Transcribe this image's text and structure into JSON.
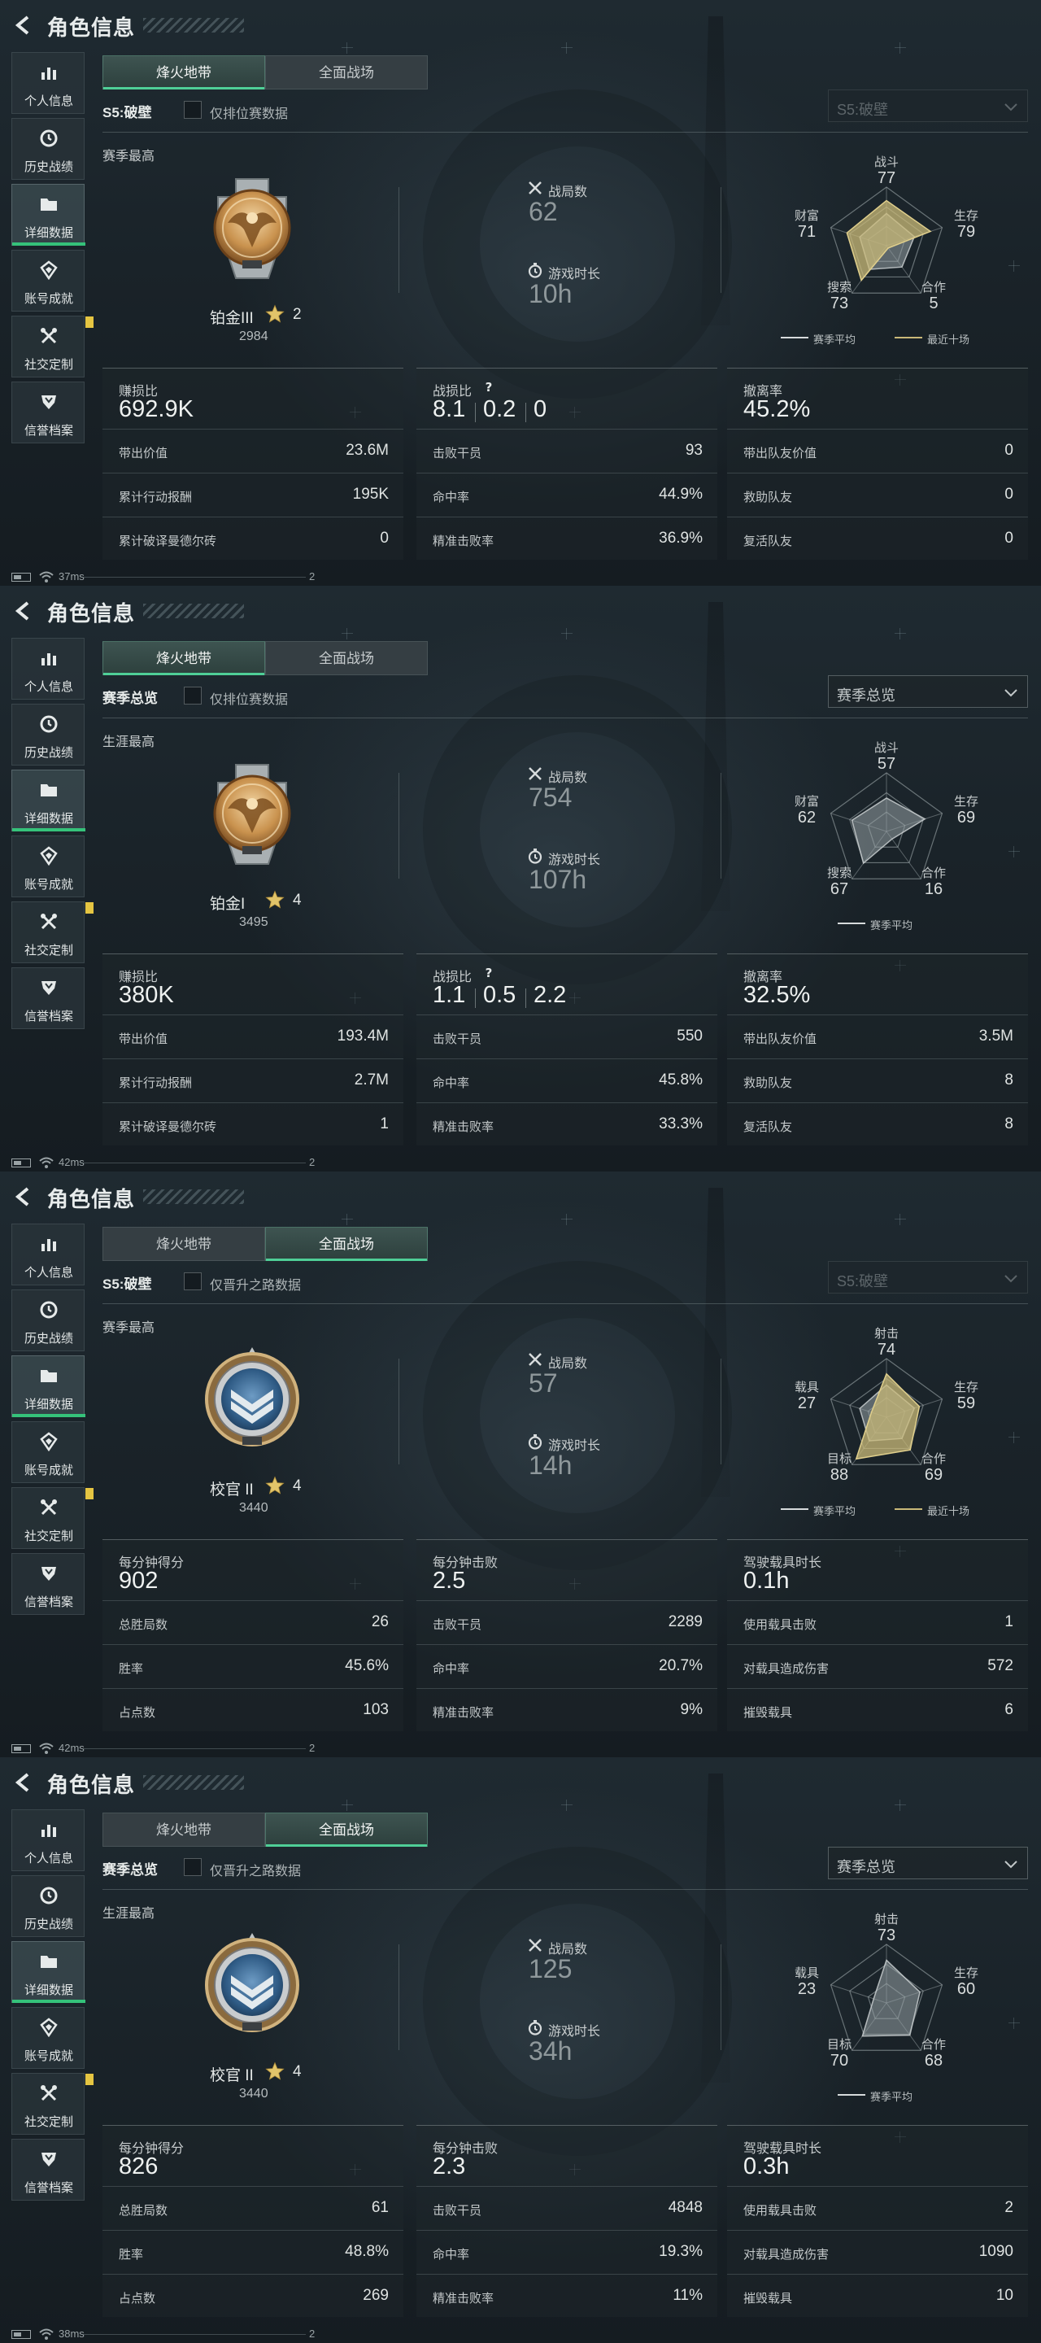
{
  "header": {
    "title": "角色信息"
  },
  "sidebar": {
    "items": [
      {
        "label": "个人信息"
      },
      {
        "label": "历史战绩"
      },
      {
        "label": "详细数据"
      },
      {
        "label": "账号成就"
      },
      {
        "label": "社交定制"
      },
      {
        "label": "信誉档案"
      }
    ]
  },
  "colors": {
    "accent_green": "#35c27a",
    "medal_gold": "#c9924e",
    "radar_current": "#c9b978",
    "radar_average": "#8c969a",
    "badge_yellow": "#e5c542"
  },
  "icons": [
    "back-arrow-icon",
    "stats-bars-icon",
    "history-clock-icon",
    "folder-icon",
    "achievement-badge-icon",
    "custom-tools-icon",
    "shield-rank-icon",
    "crossed-swords-icon",
    "stopwatch-icon",
    "help-question-icon",
    "star-icon",
    "chevron-down-icon",
    "battery-icon",
    "wifi-icon"
  ],
  "screens": [
    {
      "tabs": [
        {
          "label": "烽火地带"
        },
        {
          "label": "全面战场"
        }
      ],
      "active_tab": 0,
      "season_label": "S5:破壁",
      "checkbox_label": "仅排位赛数据",
      "select_value": "S5:破壁",
      "select_disabled": true,
      "best_label": "赛季最高",
      "medal_type": "gold-eagle",
      "rank_name": "铂金III",
      "rank_stars": "2",
      "rank_score": "2984",
      "matches_label": "战局数",
      "matches_value": "62",
      "time_label": "游戏时长",
      "time_value": "10h",
      "radar_labels": [
        "战斗",
        "生存",
        "合作",
        "搜索",
        "财富"
      ],
      "radar_values": [
        "77",
        "79",
        "5",
        "73",
        "71"
      ],
      "radar_avg": [
        0.55,
        0.5,
        0.45,
        0.5,
        0.48
      ],
      "radar_cur": [
        0.77,
        0.79,
        0.05,
        0.73,
        0.71
      ],
      "legend": [
        {
          "label": "赛季平均"
        },
        {
          "label": "最近十场"
        }
      ],
      "panels": [
        {
          "title": "赚损比",
          "big": [
            "692.9K"
          ],
          "rows": [
            {
              "label": "带出价值",
              "value": "23.6M"
            },
            {
              "label": "累计行动报酬",
              "value": "195K"
            },
            {
              "label": "累计破译曼德尔砖",
              "value": "0"
            }
          ]
        },
        {
          "title": "战损比",
          "help": true,
          "big": [
            "8.1",
            "0.2",
            "0"
          ],
          "rows": [
            {
              "label": "击败干员",
              "value": "93"
            },
            {
              "label": "命中率",
              "value": "44.9%"
            },
            {
              "label": "精准击败率",
              "value": "36.9%"
            }
          ]
        },
        {
          "title": "撤离率",
          "big": [
            "45.2%"
          ],
          "rows": [
            {
              "label": "带出队友价值",
              "value": "0"
            },
            {
              "label": "救助队友",
              "value": "0"
            },
            {
              "label": "复活队友",
              "value": "0"
            }
          ]
        }
      ],
      "status": {
        "ping": "37ms",
        "tail": "2"
      }
    },
    {
      "tabs": [
        {
          "label": "烽火地带"
        },
        {
          "label": "全面战场"
        }
      ],
      "active_tab": 0,
      "season_label": "赛季总览",
      "checkbox_label": "仅排位赛数据",
      "select_value": "赛季总览",
      "select_disabled": false,
      "best_label": "生涯最高",
      "medal_type": "gold-eagle",
      "rank_name": "铂金I",
      "rank_stars": "4",
      "rank_score": "3495",
      "matches_label": "战局数",
      "matches_value": "754",
      "time_label": "游戏时长",
      "time_value": "107h",
      "radar_labels": [
        "战斗",
        "生存",
        "合作",
        "搜索",
        "财富"
      ],
      "radar_values": [
        "57",
        "69",
        "16",
        "67",
        "62"
      ],
      "radar_avg": [
        0.57,
        0.69,
        0.16,
        0.67,
        0.62
      ],
      "radar_cur": null,
      "legend": [
        {
          "label": "赛季平均"
        }
      ],
      "panels": [
        {
          "title": "赚损比",
          "big": [
            "380K"
          ],
          "rows": [
            {
              "label": "带出价值",
              "value": "193.4M"
            },
            {
              "label": "累计行动报酬",
              "value": "2.7M"
            },
            {
              "label": "累计破译曼德尔砖",
              "value": "1"
            }
          ]
        },
        {
          "title": "战损比",
          "help": true,
          "big": [
            "1.1",
            "0.5",
            "2.2"
          ],
          "rows": [
            {
              "label": "击败干员",
              "value": "550"
            },
            {
              "label": "命中率",
              "value": "45.8%"
            },
            {
              "label": "精准击败率",
              "value": "33.3%"
            }
          ]
        },
        {
          "title": "撤离率",
          "big": [
            "32.5%"
          ],
          "rows": [
            {
              "label": "带出队友价值",
              "value": "3.5M"
            },
            {
              "label": "救助队友",
              "value": "8"
            },
            {
              "label": "复活队友",
              "value": "8"
            }
          ]
        }
      ],
      "status": {
        "ping": "42ms",
        "tail": "2"
      }
    },
    {
      "tabs": [
        {
          "label": "烽火地带"
        },
        {
          "label": "全面战场"
        }
      ],
      "active_tab": 1,
      "season_label": "S5:破壁",
      "checkbox_label": "仅晋升之路数据",
      "select_value": "S5:破壁",
      "select_disabled": true,
      "best_label": "赛季最高",
      "medal_type": "chevron-officer",
      "rank_name": "校官 II",
      "rank_stars": "4",
      "rank_score": "3440",
      "matches_label": "战局数",
      "matches_value": "57",
      "time_label": "游戏时长",
      "time_value": "14h",
      "radar_labels": [
        "射击",
        "生存",
        "合作",
        "目标",
        "载具"
      ],
      "radar_values": [
        "74",
        "59",
        "69",
        "88",
        "27"
      ],
      "radar_avg": [
        0.55,
        0.5,
        0.45,
        0.5,
        0.48
      ],
      "radar_cur": [
        0.74,
        0.59,
        0.69,
        0.88,
        0.27
      ],
      "legend": [
        {
          "label": "赛季平均"
        },
        {
          "label": "最近十场"
        }
      ],
      "panels": [
        {
          "title": "每分钟得分",
          "big": [
            "902"
          ],
          "rows": [
            {
              "label": "总胜局数",
              "value": "26"
            },
            {
              "label": "胜率",
              "value": "45.6%"
            },
            {
              "label": "占点数",
              "value": "103"
            }
          ]
        },
        {
          "title": "每分钟击败",
          "big": [
            "2.5"
          ],
          "rows": [
            {
              "label": "击败干员",
              "value": "2289"
            },
            {
              "label": "命中率",
              "value": "20.7%"
            },
            {
              "label": "精准击败率",
              "value": "9%"
            }
          ]
        },
        {
          "title": "驾驶载具时长",
          "big": [
            "0.1h"
          ],
          "rows": [
            {
              "label": "使用载具击败",
              "value": "1"
            },
            {
              "label": "对载具造成伤害",
              "value": "572"
            },
            {
              "label": "摧毁载具",
              "value": "6"
            }
          ]
        }
      ],
      "status": {
        "ping": "42ms",
        "tail": "2"
      }
    },
    {
      "tabs": [
        {
          "label": "烽火地带"
        },
        {
          "label": "全面战场"
        }
      ],
      "active_tab": 1,
      "season_label": "赛季总览",
      "checkbox_label": "仅晋升之路数据",
      "select_value": "赛季总览",
      "select_disabled": false,
      "best_label": "生涯最高",
      "medal_type": "chevron-officer",
      "rank_name": "校官 II",
      "rank_stars": "4",
      "rank_score": "3440",
      "matches_label": "战局数",
      "matches_value": "125",
      "time_label": "游戏时长",
      "time_value": "34h",
      "radar_labels": [
        "射击",
        "生存",
        "合作",
        "目标",
        "载具"
      ],
      "radar_values": [
        "73",
        "60",
        "68",
        "70",
        "23"
      ],
      "radar_avg": [
        0.73,
        0.6,
        0.68,
        0.7,
        0.23
      ],
      "radar_cur": null,
      "legend": [
        {
          "label": "赛季平均"
        }
      ],
      "panels": [
        {
          "title": "每分钟得分",
          "big": [
            "826"
          ],
          "rows": [
            {
              "label": "总胜局数",
              "value": "61"
            },
            {
              "label": "胜率",
              "value": "48.8%"
            },
            {
              "label": "占点数",
              "value": "269"
            }
          ]
        },
        {
          "title": "每分钟击败",
          "big": [
            "2.3"
          ],
          "rows": [
            {
              "label": "击败干员",
              "value": "4848"
            },
            {
              "label": "命中率",
              "value": "19.3%"
            },
            {
              "label": "精准击败率",
              "value": "11%"
            }
          ]
        },
        {
          "title": "驾驶载具时长",
          "big": [
            "0.3h"
          ],
          "rows": [
            {
              "label": "使用载具击败",
              "value": "2"
            },
            {
              "label": "对载具造成伤害",
              "value": "1090"
            },
            {
              "label": "摧毁载具",
              "value": "10"
            }
          ]
        }
      ],
      "status": {
        "ping": "38ms",
        "tail": "2"
      }
    }
  ]
}
